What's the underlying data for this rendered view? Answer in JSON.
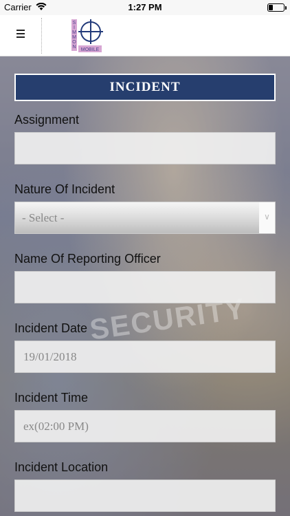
{
  "status_bar": {
    "carrier": "Carrier",
    "time": "1:27 PM"
  },
  "header": {
    "logo_text": "SIMMONS MOBILE"
  },
  "form": {
    "title": "INCIDENT",
    "fields": [
      {
        "label": "Assignment",
        "value": "",
        "type": "text"
      },
      {
        "label": "Nature Of Incident",
        "value": "- Select -",
        "type": "select"
      },
      {
        "label": "Name Of Reporting Officer",
        "value": "",
        "type": "text"
      },
      {
        "label": "Incident Date",
        "value": "19/01/2018",
        "type": "text"
      },
      {
        "label": "Incident Time",
        "value": "",
        "placeholder": "ex(02:00 PM)",
        "type": "text"
      },
      {
        "label": "Incident Location",
        "value": "",
        "type": "text"
      }
    ]
  },
  "background": {
    "watermark": "SECURITY"
  },
  "colors": {
    "title_bg": "#263e6e",
    "title_text": "#ffffff"
  }
}
